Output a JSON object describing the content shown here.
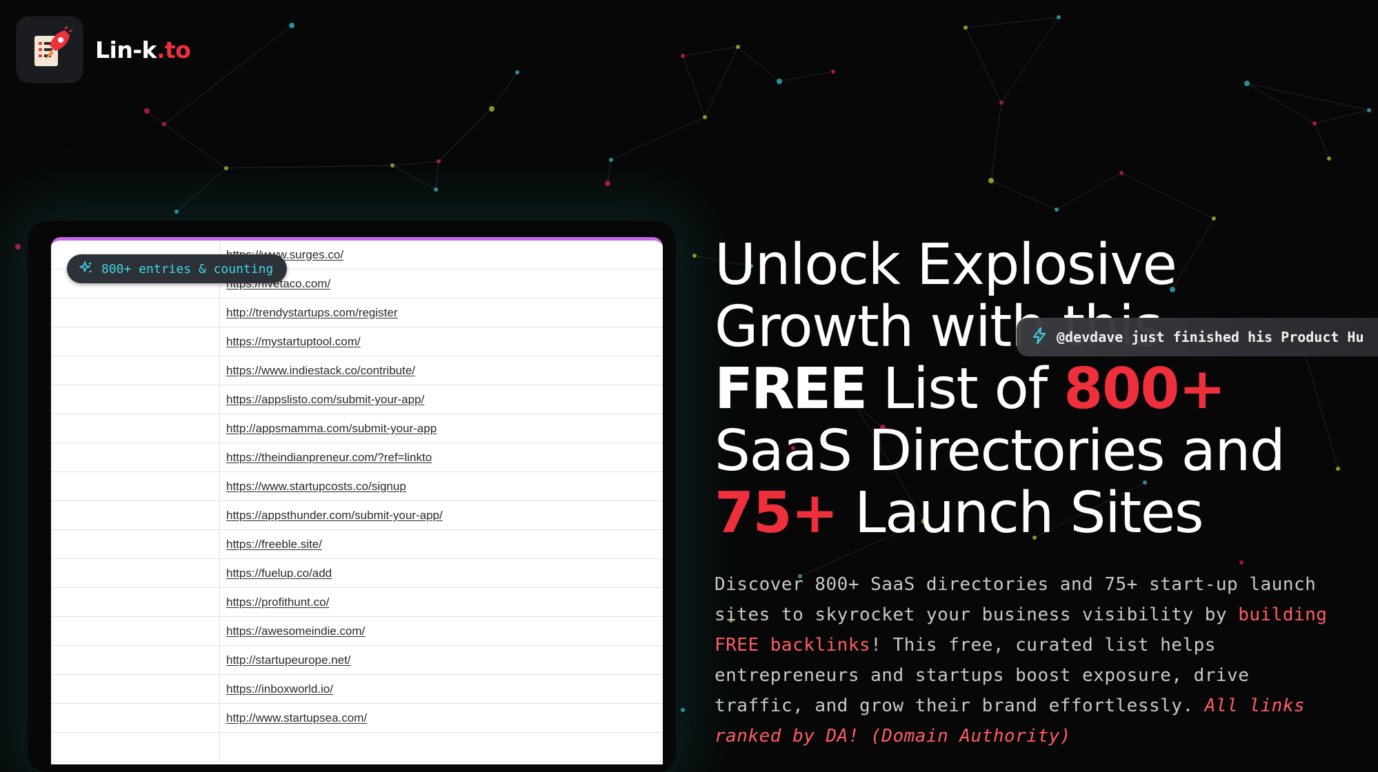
{
  "brand": {
    "name_main": "Lin-k",
    "name_accent": ".to",
    "accent_color": "#ef2f3c"
  },
  "badge": {
    "text": "800+ entries & counting",
    "icon": "sparkles-icon",
    "color": "#3fd6e4"
  },
  "sheet": {
    "top_border_color": "#c868e8",
    "rows": [
      "https://www.surges.co/",
      "https://fivetaco.com/",
      "http://trendystartups.com/register",
      "https://mystartuptool.com/",
      "https://www.indiestack.co/contribute/",
      "https://appslisto.com/submit-your-app/",
      "http://appsmamma.com/submit-your-app",
      "https://theindianpreneur.com/?ref=linkto",
      "https://www.startupcosts.co/signup",
      "https://appsthunder.com/submit-your-app/",
      "https://freeble.site/",
      "https://fuelup.co/add",
      "https://profithunt.co/",
      "https://awesomeindie.com/",
      "http://startupeurope.net/",
      "https://inboxworld.io/",
      "http://www.startupsea.com/",
      ""
    ]
  },
  "hero": {
    "line1": "Unlock Explosive",
    "line2": "Growth with this",
    "line3_free": "FREE",
    "line3_mid": " List of ",
    "line3_num": "800+",
    "line4": "SaaS Directories and",
    "line5_num": "75+",
    "line5_rest": " Launch Sites"
  },
  "toast": {
    "icon": "lightning-icon",
    "text": "@devdave just finished his Product Hu"
  },
  "description": {
    "part1": "Discover 800+ SaaS directories and 75+ start-up launch sites to skyrocket your business visibility by ",
    "highlight": "building FREE backlinks",
    "part2": "! This free, curated list helps entrepreneurs and startups boost exposure, drive traffic, and grow their brand effortlessly. ",
    "italic": "All links ranked by DA! (Domain Authority)"
  },
  "colors": {
    "background": "#070707",
    "hero_red": "#ef2f3c",
    "desc_highlight": "#ff5d64",
    "network_cyan": "#2aa7b8",
    "network_magenta": "#c2185b",
    "network_lime": "#9bb42a"
  }
}
